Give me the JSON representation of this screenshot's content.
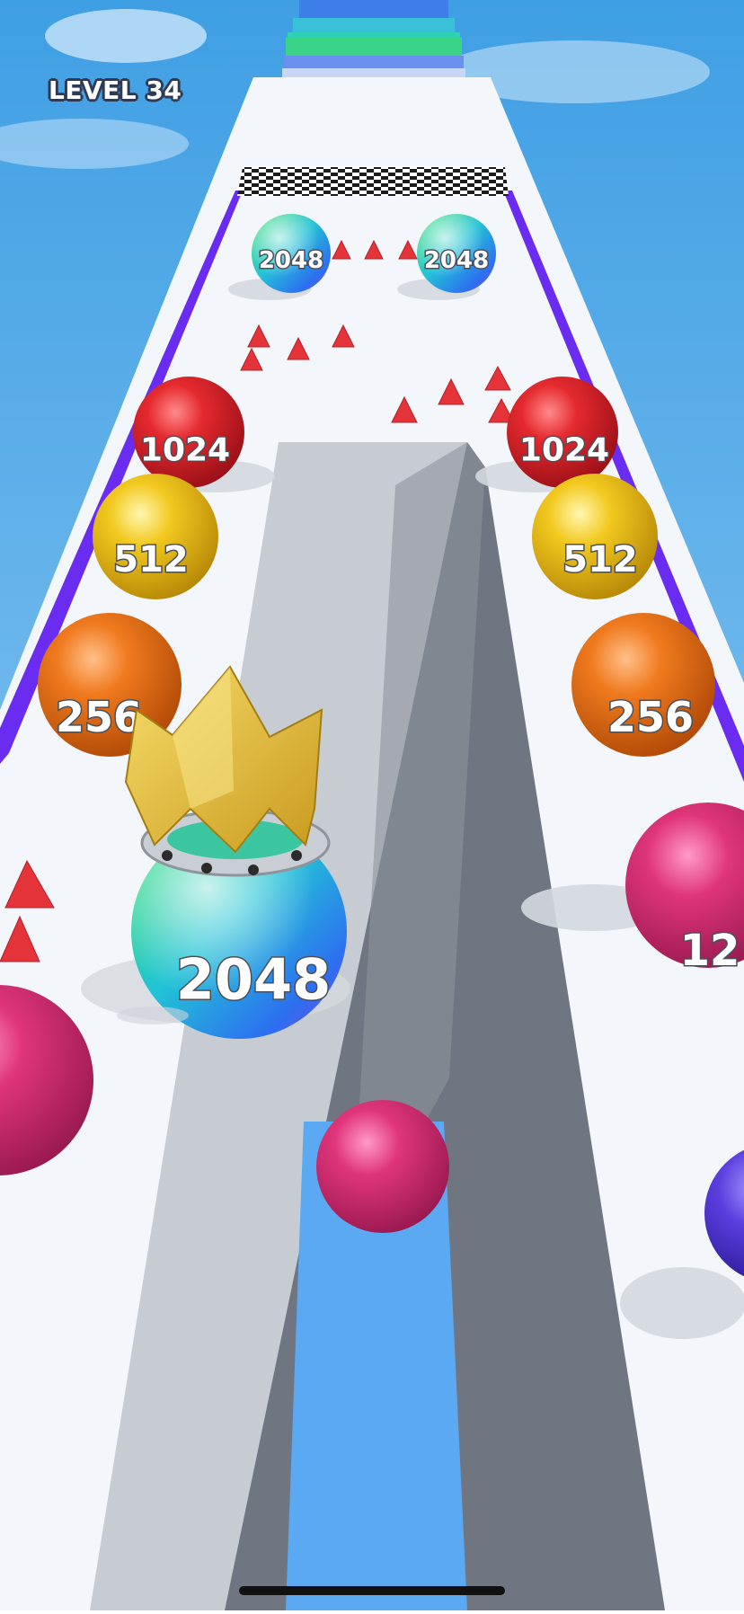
{
  "hud": {
    "level_label": "LEVEL 34"
  },
  "balls": [
    {
      "value": "2048",
      "color": "rainbow"
    },
    {
      "value": "2048",
      "color": "rainbow"
    },
    {
      "value": "1024",
      "color": "#d8232b"
    },
    {
      "value": "1024",
      "color": "#d8232b"
    },
    {
      "value": "512",
      "color": "#f0c21a"
    },
    {
      "value": "512",
      "color": "#f0c21a"
    },
    {
      "value": "256",
      "color": "#f07a1e"
    },
    {
      "value": "256",
      "color": "#f07a1e"
    },
    {
      "value": "12",
      "color": "#e0357a"
    },
    {
      "value": "2048",
      "color": "rainbow",
      "player": true,
      "crown": true
    }
  ],
  "colors": {
    "sky_top": "#4aa6e6",
    "sky_bottom": "#9fd2f5",
    "track": "#f3f6fa",
    "rail": "#6a2cf0",
    "ramp_light": "#b9bfc6",
    "ramp_dark": "#6e7480",
    "water": "#5aa9f2",
    "spike": "#e5333a",
    "crown": "#e8c23a"
  }
}
